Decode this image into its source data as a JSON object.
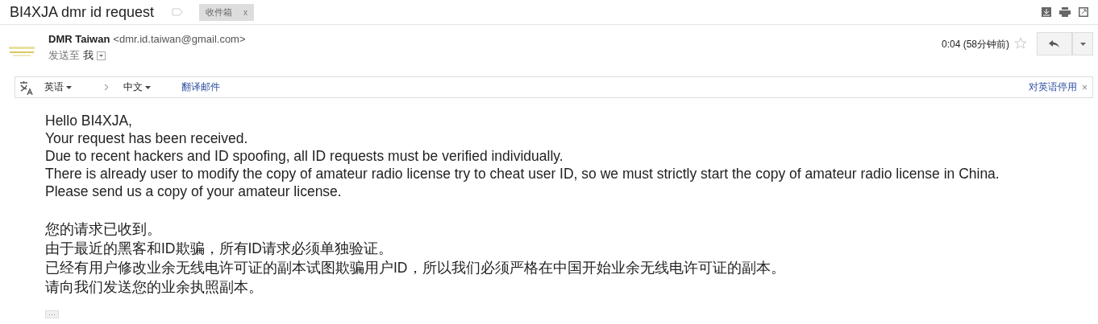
{
  "subject": "BI4XJA dmr id request",
  "labels": [
    {
      "text": "收件箱",
      "remove": "x"
    }
  ],
  "message": {
    "sender_name": "DMR Taiwan",
    "sender_email": "<dmr.id.taiwan@gmail.com>",
    "recipient_prefix": "发送至",
    "recipient": "我",
    "time": "0:04 (58分钟前)",
    "starred": false
  },
  "translate_bar": {
    "source_language": "英语",
    "target_language": "中文",
    "translate_link": "翻译邮件",
    "disable_link": "对英语停用",
    "close": "×"
  },
  "body": {
    "paragraphs": [
      [
        "Hello BI4XJA,",
        "Your request has been received.",
        "Due to recent hackers and ID spoofing, all ID requests must be verified individually.",
        "There is already user to modify the copy of amateur radio license try to cheat user ID, so we must strictly start the copy of amateur radio license in China.",
        "Please send us a copy of your amateur license."
      ],
      [
        "您的请求已收到。",
        "由于最近的黑客和ID欺骗，所有ID请求必须单独验证。",
        "已经有用户修改业余无线电许可证的副本试图欺骗用户ID，所以我们必须严格在中国开始业余无线电许可证的副本。",
        "请向我们发送您的业余执照副本。"
      ]
    ],
    "more": "···"
  }
}
